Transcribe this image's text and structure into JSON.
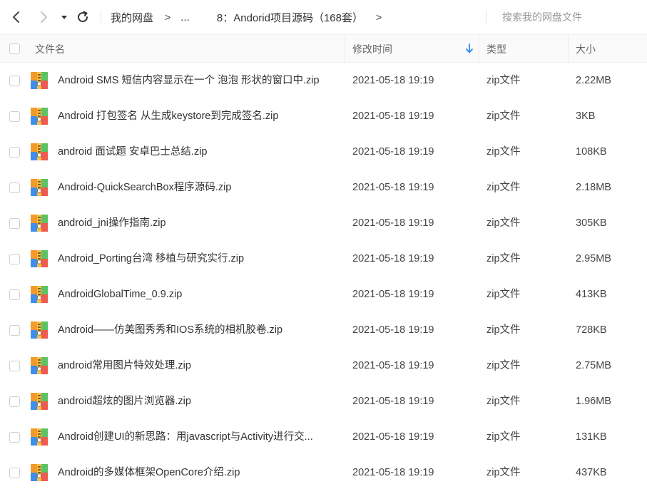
{
  "nav": {
    "breadcrumb": [
      {
        "label": "我的网盘"
      },
      {
        "label": "..."
      },
      {
        "label": "8：Andorid项目源码（168套）"
      }
    ],
    "arrow": ">"
  },
  "search": {
    "placeholder": "搜索我的网盘文件"
  },
  "columns": {
    "name": "文件名",
    "modified": "修改时间",
    "type": "类型",
    "size": "大小"
  },
  "sort": {
    "column": "modified",
    "direction": "descending"
  },
  "colors": {
    "sort_accent": "#2a8bf2",
    "icon_orange": "#f39a2b",
    "icon_green": "#5cc263",
    "icon_blue": "#3c8ff0",
    "icon_red": "#ee5a4f"
  },
  "files": [
    {
      "name": "Android SMS 短信内容显示在一个 泡泡 形状的窗口中.zip",
      "modified": "2021-05-18 19:19",
      "type": "zip文件",
      "size": "2.22MB"
    },
    {
      "name": "Android 打包签名 从生成keystore到完成签名.zip",
      "modified": "2021-05-18 19:19",
      "type": "zip文件",
      "size": "3KB"
    },
    {
      "name": "android 面试题 安卓巴士总结.zip",
      "modified": "2021-05-18 19:19",
      "type": "zip文件",
      "size": "108KB"
    },
    {
      "name": "Android-QuickSearchBox程序源码.zip",
      "modified": "2021-05-18 19:19",
      "type": "zip文件",
      "size": "2.18MB"
    },
    {
      "name": "android_jni操作指南.zip",
      "modified": "2021-05-18 19:19",
      "type": "zip文件",
      "size": "305KB"
    },
    {
      "name": "Android_Porting台湾 移植与研究实行.zip",
      "modified": "2021-05-18 19:19",
      "type": "zip文件",
      "size": "2.95MB"
    },
    {
      "name": "AndroidGlobalTime_0.9.zip",
      "modified": "2021-05-18 19:19",
      "type": "zip文件",
      "size": "413KB"
    },
    {
      "name": "Android——仿美图秀秀和IOS系统的相机胶卷.zip",
      "modified": "2021-05-18 19:19",
      "type": "zip文件",
      "size": "728KB"
    },
    {
      "name": "android常用图片特效处理.zip",
      "modified": "2021-05-18 19:19",
      "type": "zip文件",
      "size": "2.75MB"
    },
    {
      "name": "android超炫的图片浏览器.zip",
      "modified": "2021-05-18 19:19",
      "type": "zip文件",
      "size": "1.96MB"
    },
    {
      "name": "Android创建UI的新思路：用javascript与Activity进行交...",
      "modified": "2021-05-18 19:19",
      "type": "zip文件",
      "size": "131KB"
    },
    {
      "name": "Android的多媒体框架OpenCore介绍.zip",
      "modified": "2021-05-18 19:19",
      "type": "zip文件",
      "size": "437KB"
    }
  ]
}
